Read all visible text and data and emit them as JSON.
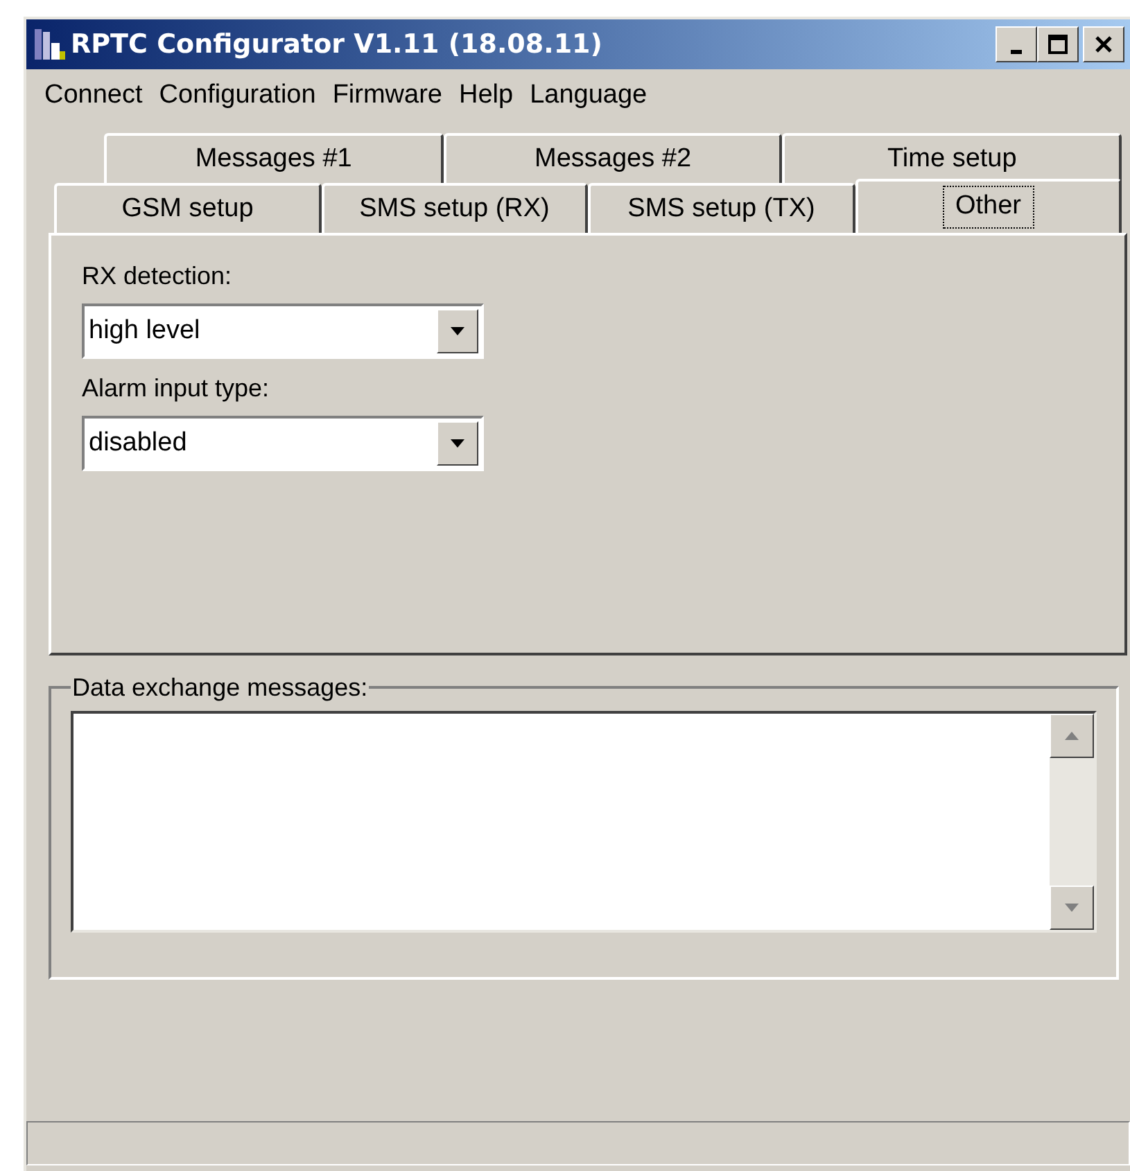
{
  "window": {
    "title": "RPTC Configurator V1.11 (18.08.11)"
  },
  "menu": [
    "Connect",
    "Configuration",
    "Firmware",
    "Help",
    "Language"
  ],
  "tab_rows": [
    [
      {
        "label": "Messages #1",
        "selected": false
      },
      {
        "label": "Messages #2",
        "selected": false
      },
      {
        "label": "Time setup",
        "selected": false
      }
    ],
    [
      {
        "label": "GSM setup",
        "selected": false
      },
      {
        "label": "SMS setup (RX)",
        "selected": false
      },
      {
        "label": "SMS setup (TX)",
        "selected": false
      },
      {
        "label": "Other",
        "selected": true
      }
    ]
  ],
  "fields": [
    {
      "label": "RX detection:",
      "value": "high level"
    },
    {
      "label": "Alarm input type:",
      "value": "disabled"
    }
  ],
  "messages_group": {
    "title": "Data exchange messages:"
  }
}
